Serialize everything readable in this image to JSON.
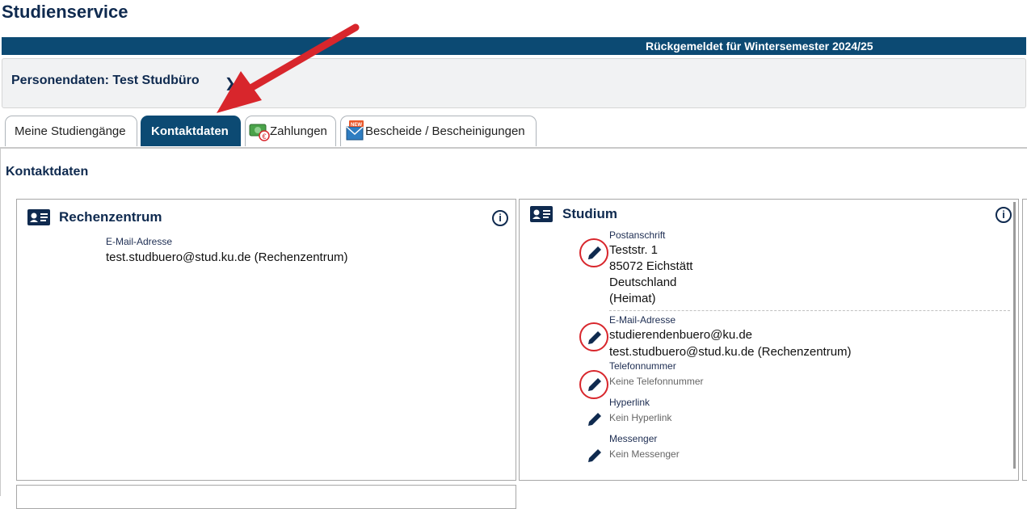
{
  "app": {
    "title": "Studienservice"
  },
  "status": {
    "text": "Rückgemeldet für Wintersemester 2024/25"
  },
  "person": {
    "title": "Personendaten: Test Studbüro"
  },
  "tabs": [
    {
      "label": "Meine Studiengänge"
    },
    {
      "label": "Kontaktdaten"
    },
    {
      "label": "Zahlungen"
    },
    {
      "label": "Bescheide / Bescheinigungen",
      "badge": "NEW"
    }
  ],
  "section": {
    "title": "Kontaktdaten"
  },
  "cards": {
    "rechenzentrum": {
      "title": "Rechenzentrum",
      "email_label": "E-Mail-Adresse",
      "email_value": "test.studbuero@stud.ku.de (Rechenzentrum)"
    },
    "studium": {
      "title": "Studium",
      "postal_label": "Postanschrift",
      "postal_lines": [
        "Teststr. 1",
        "85072 Eichstätt",
        "Deutschland",
        "(Heimat)"
      ],
      "email_label": "E-Mail-Adresse",
      "email_values": [
        "studierendenbuero@ku.de",
        "test.studbuero@stud.ku.de (Rechenzentrum)"
      ],
      "phone_label": "Telefonnummer",
      "phone_value": "Keine Telefonnummer",
      "hyperlink_label": "Hyperlink",
      "hyperlink_value": "Kein Hyperlink",
      "messenger_label": "Messenger",
      "messenger_value": "Kein Messenger"
    }
  },
  "colors": {
    "primary": "#0c4a73",
    "annotation": "#d8262c"
  }
}
